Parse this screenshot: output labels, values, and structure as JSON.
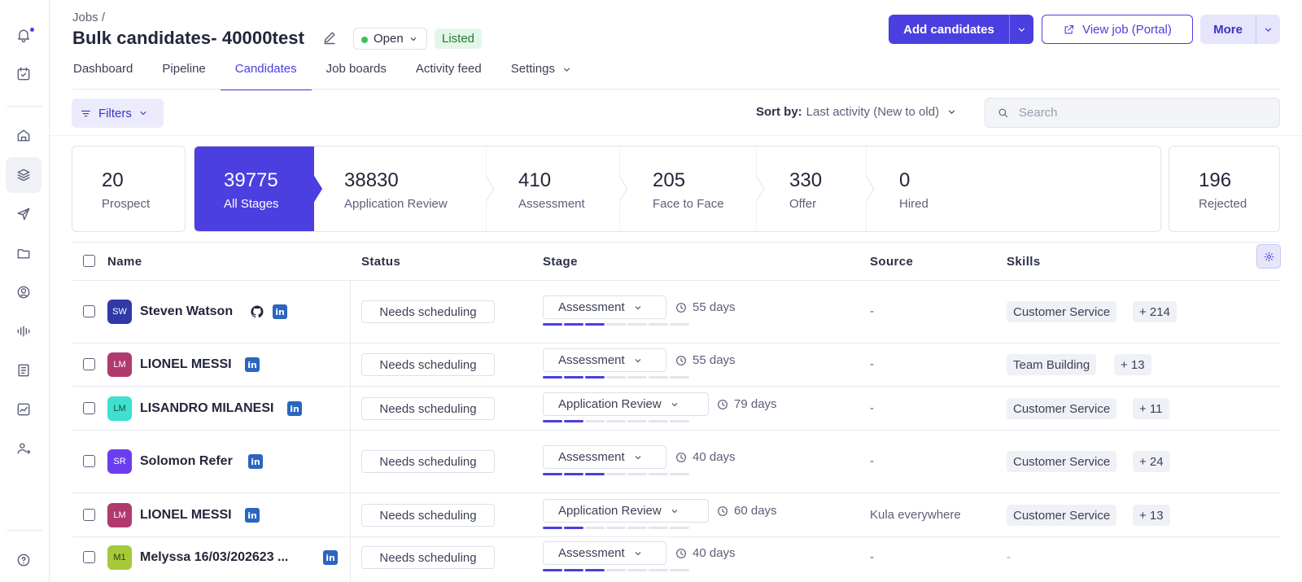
{
  "breadcrumb": "Jobs /",
  "job": {
    "title": "Bulk candidates- 40000test",
    "status": "Open",
    "listing": "Listed"
  },
  "actions": {
    "add_candidates": "Add candidates",
    "view_job": "View job (Portal)",
    "more": "More"
  },
  "tabs": [
    "Dashboard",
    "Pipeline",
    "Candidates",
    "Job boards",
    "Activity feed",
    "Settings"
  ],
  "active_tab": "Candidates",
  "toolbar": {
    "filters": "Filters",
    "sort_label": "Sort by:",
    "sort_value": "Last activity (New to old)",
    "search_placeholder": "Search"
  },
  "stages": {
    "prospect": {
      "count": "20",
      "label": "Prospect"
    },
    "pipeline": [
      {
        "count": "39775",
        "label": "All Stages",
        "active": true
      },
      {
        "count": "38830",
        "label": "Application Review"
      },
      {
        "count": "410",
        "label": "Assessment"
      },
      {
        "count": "205",
        "label": "Face to Face"
      },
      {
        "count": "330",
        "label": "Offer"
      },
      {
        "count": "0",
        "label": "Hired"
      }
    ],
    "rejected": {
      "count": "196",
      "label": "Rejected"
    }
  },
  "table": {
    "columns": [
      "Name",
      "Status",
      "Stage",
      "Source",
      "Skills"
    ],
    "rows": [
      {
        "initials": "SW",
        "name": "Steven Watson",
        "avatar_color": "#2f3aa8",
        "github": true,
        "linkedin": true,
        "status": "Needs scheduling",
        "stage": "Assessment",
        "progress": "3/7",
        "days": "55 days",
        "source": "-",
        "skill": "Customer Service",
        "more_skills": "+ 214"
      },
      {
        "initials": "LM",
        "name": "LIONEL MESSI",
        "avatar_color": "#b03a6e",
        "github": false,
        "linkedin": true,
        "status": "Needs scheduling",
        "stage": "Assessment",
        "progress": "3/7",
        "days": "55 days",
        "source": "-",
        "skill": "Team Building",
        "more_skills": "+ 13"
      },
      {
        "initials": "LM",
        "name": "LISANDRO MILANESI",
        "avatar_color": "#3fe0cf",
        "avatar_text": "#1b4a45",
        "github": false,
        "linkedin": true,
        "status": "Needs scheduling",
        "stage": "Application Review",
        "progress": "2/7",
        "days": "79 days",
        "source": "-",
        "skill": "Customer Service",
        "more_skills": "+ 11"
      },
      {
        "initials": "SR",
        "name": "Solomon Refer",
        "avatar_color": "#6a3ef0",
        "github": false,
        "linkedin": true,
        "status": "Needs scheduling",
        "stage": "Assessment",
        "progress": "3/7",
        "days": "40 days",
        "source": "-",
        "skill": "Customer Service",
        "more_skills": "+ 24"
      },
      {
        "initials": "LM",
        "name": "LIONEL MESSI",
        "avatar_color": "#b03a6e",
        "github": false,
        "linkedin": true,
        "status": "Needs scheduling",
        "stage": "Application Review",
        "progress": "2/7",
        "days": "60 days",
        "source": "Kula everywhere",
        "skill": "Customer Service",
        "more_skills": "+ 13"
      },
      {
        "initials": "M1",
        "name": "Melyssa 16/03/202623 ...",
        "avatar_color": "#a6c93a",
        "avatar_text": "#2f3a10",
        "github": false,
        "linkedin": true,
        "status": "Needs scheduling",
        "stage": "Assessment",
        "progress": "3/7",
        "days": "40 days",
        "source": "-",
        "skill": "-",
        "more_skills": ""
      }
    ]
  },
  "colors": {
    "accent": "#4b3fe0",
    "listed_bg": "#e4f6e7",
    "open_dot": "#39c15a"
  }
}
